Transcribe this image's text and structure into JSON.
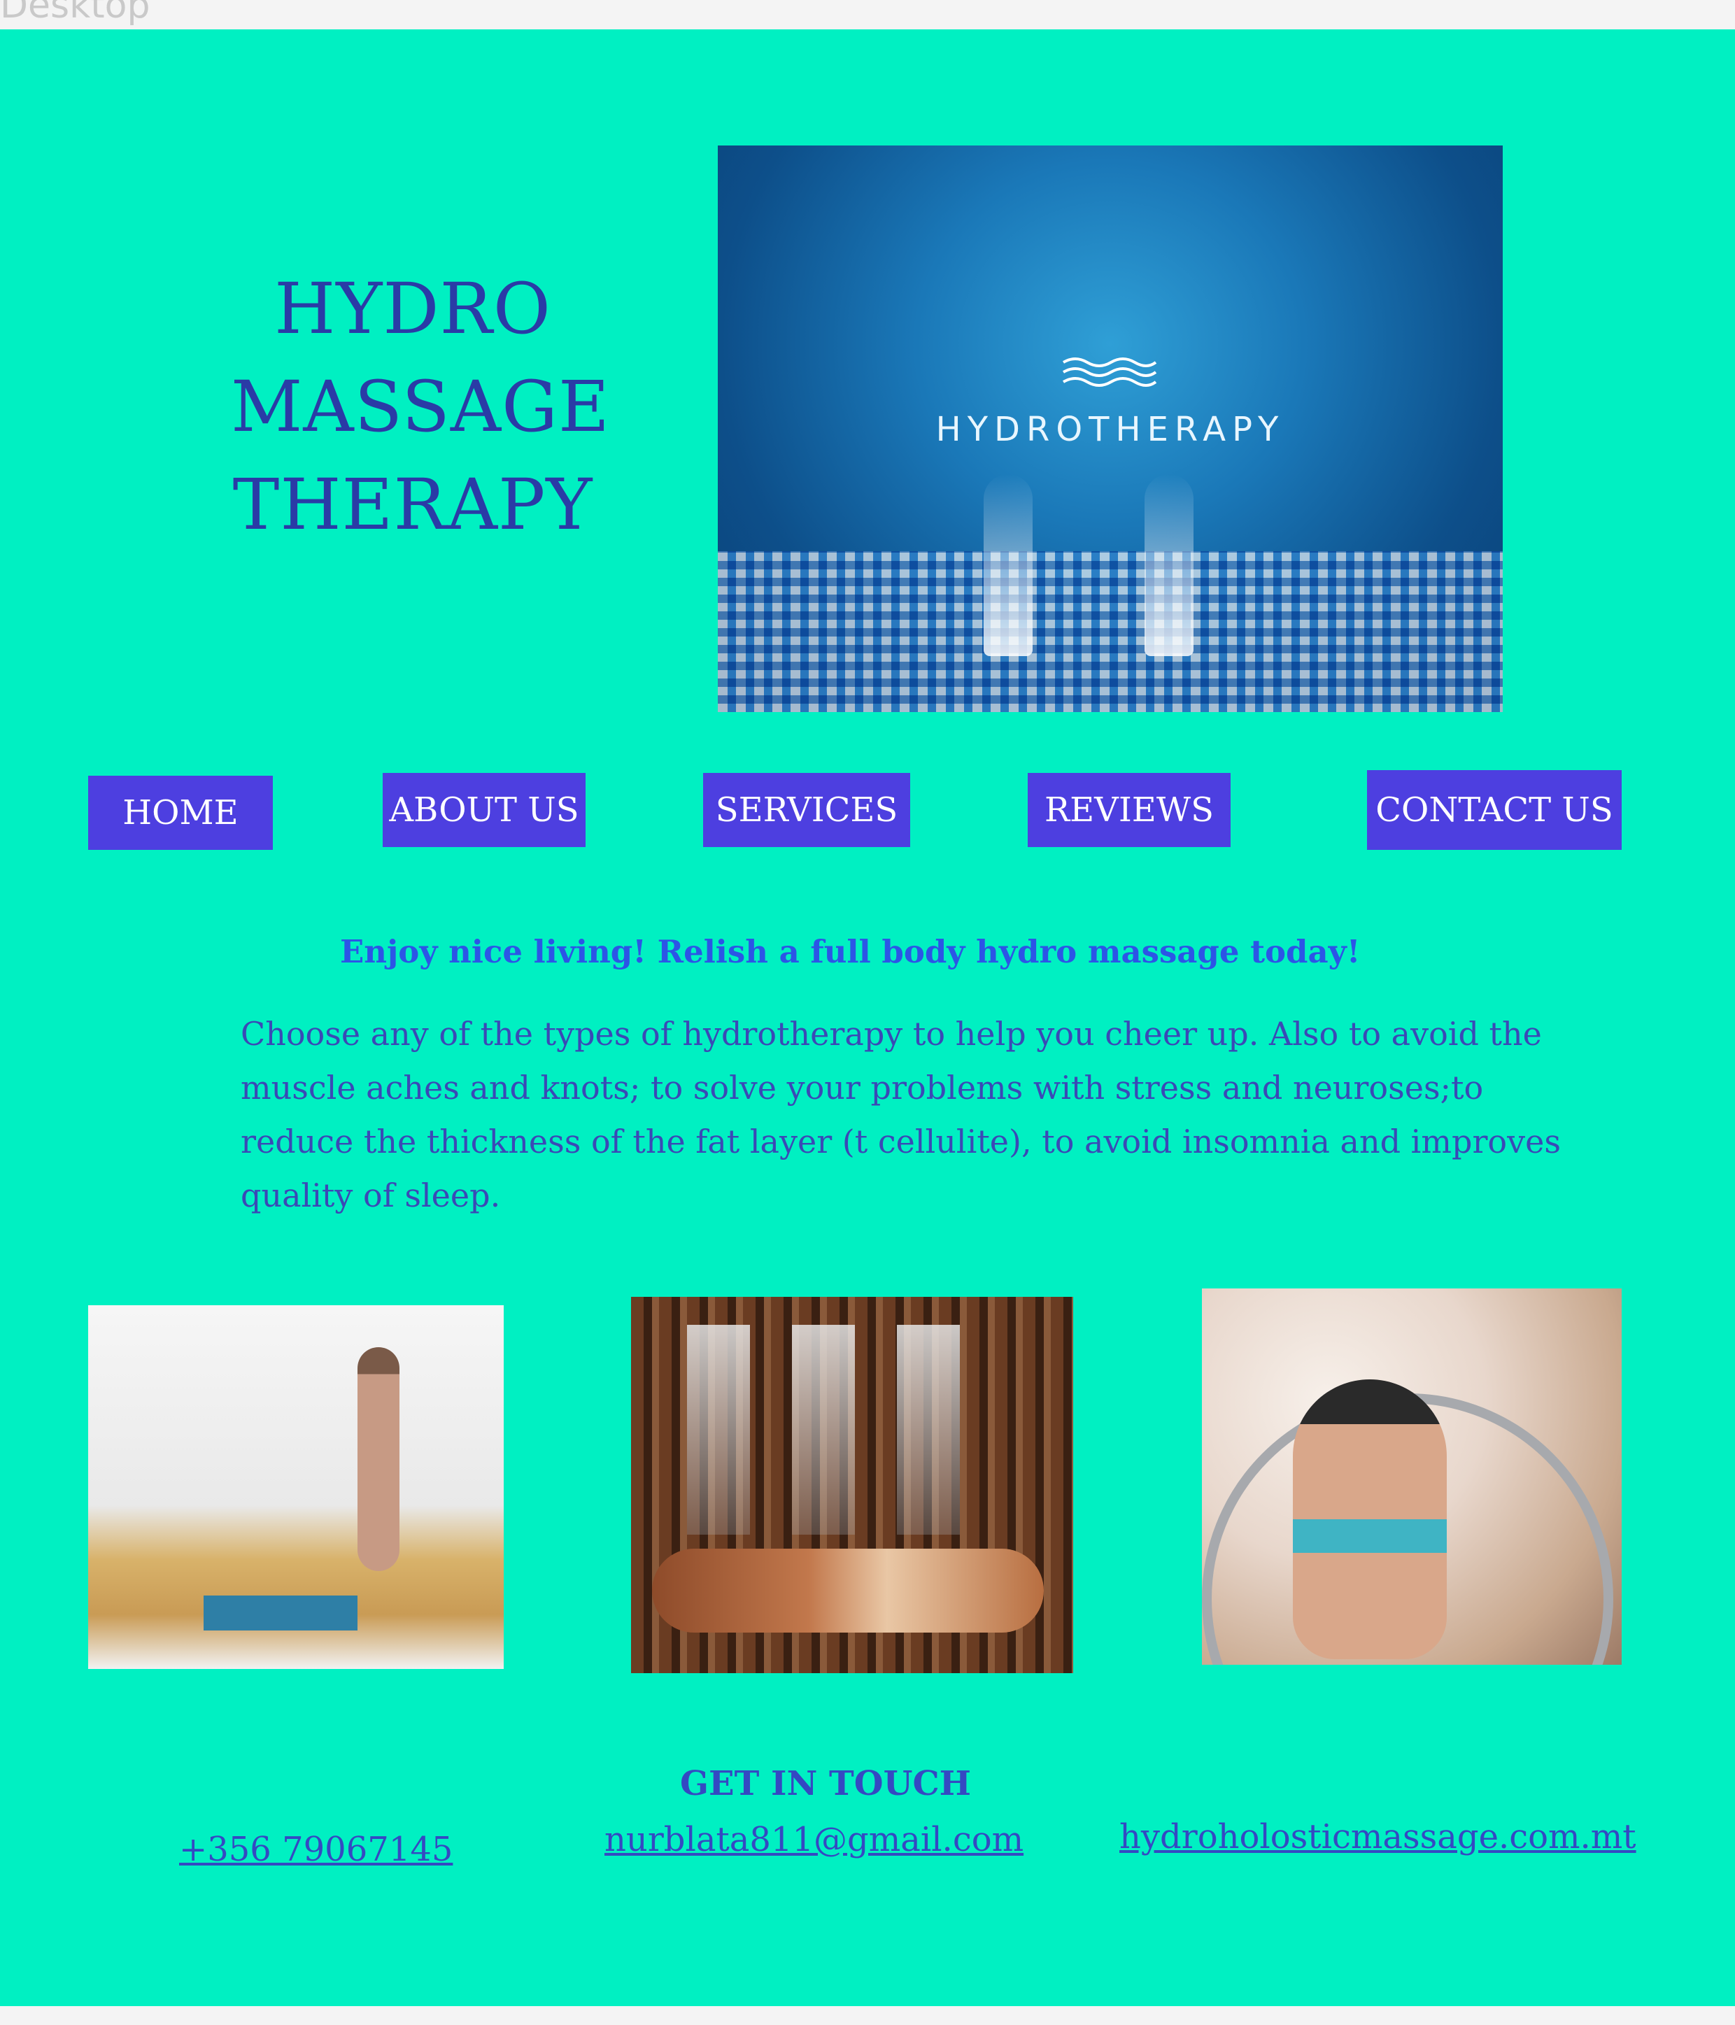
{
  "browser_strip": {
    "ghost_text": "Desktop"
  },
  "header": {
    "brand_lines": [
      "HYDRO",
      "MASSAGE",
      "THERAPY"
    ],
    "hero_image_text": "HYDROTHERAPY"
  },
  "nav": {
    "items": [
      {
        "label": "HOME"
      },
      {
        "label": "ABOUT US"
      },
      {
        "label": "SERVICES"
      },
      {
        "label": "REVIEWS"
      },
      {
        "label": "CONTACT US"
      }
    ]
  },
  "main": {
    "tagline": "Enjoy nice living! Relish a full body hydro massage today!",
    "intro": "Choose any of the types of hydrotherapy to help you cheer up. Also to avoid the muscle aches and knots; to solve your problems with stress and neuroses;to reduce the thickness of the fat layer (t cellulite), to avoid insomnia and improves quality of sleep."
  },
  "contact": {
    "heading": "GET IN TOUCH",
    "phone": "+356 79067145",
    "email": "nurblata811@gmail.com",
    "website": "hydroholosticmassage.com.mt"
  },
  "colors": {
    "page_background": "#00f0c2",
    "nav_button": "#4d3fe0",
    "brand_text": "#2a3ba6",
    "tagline_text": "#2c55e6"
  },
  "icons": {
    "hero_logo": "waves-icon"
  }
}
